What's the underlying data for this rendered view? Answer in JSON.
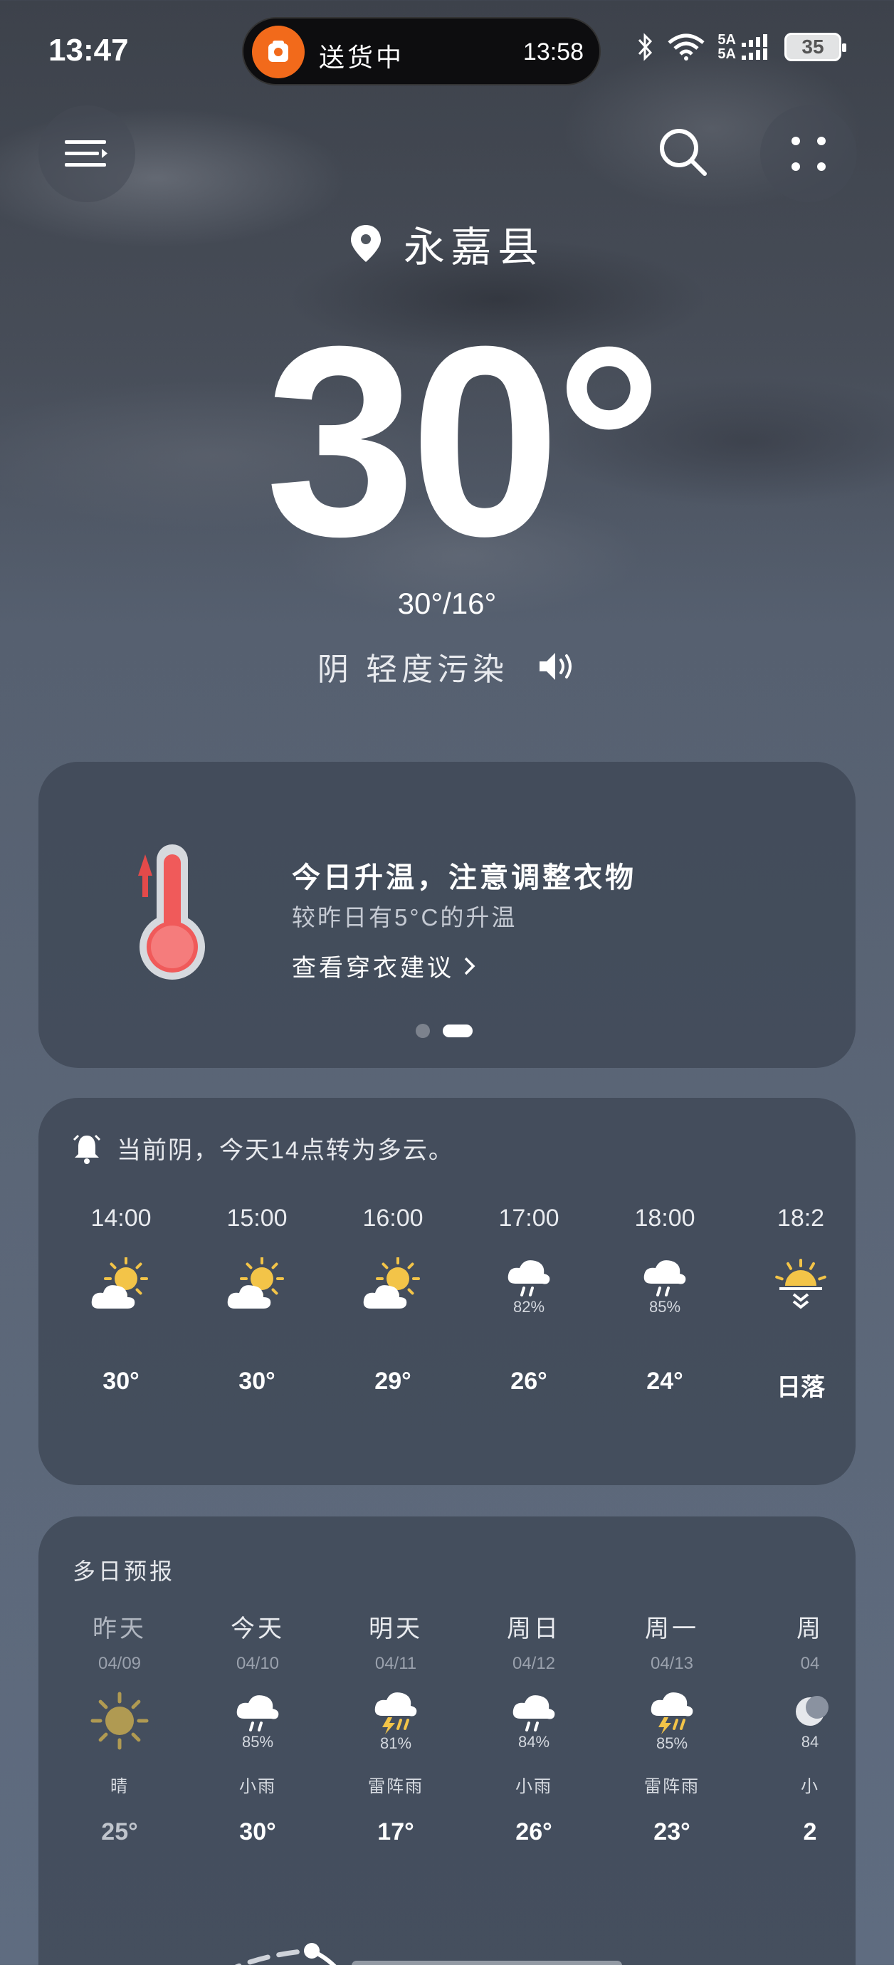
{
  "status_bar": {
    "time": "13:47",
    "island_text": "送货中",
    "island_time": "13:58",
    "network_a": "5A",
    "network_b": "5A",
    "battery": "35"
  },
  "location": {
    "name": "永嘉县"
  },
  "current": {
    "temperature": "30°",
    "high_low": "30°/16°",
    "condition": "阴 轻度污染"
  },
  "tip_card": {
    "title": "今日升温，注意调整衣物",
    "subtitle": "较昨日有5°C的升温",
    "link": "查看穿衣建议",
    "active_page": 2,
    "pages": 2
  },
  "hourly": {
    "alert": "当前阴，今天14点转为多云。",
    "items": [
      {
        "time": "14:00",
        "icon": "partly-sunny-icon",
        "prob": "",
        "temp": "30°"
      },
      {
        "time": "15:00",
        "icon": "partly-sunny-icon",
        "prob": "",
        "temp": "30°"
      },
      {
        "time": "16:00",
        "icon": "partly-sunny-icon",
        "prob": "",
        "temp": "29°"
      },
      {
        "time": "17:00",
        "icon": "rain-icon",
        "prob": "82%",
        "temp": "26°"
      },
      {
        "time": "18:00",
        "icon": "rain-icon",
        "prob": "85%",
        "temp": "24°"
      },
      {
        "time": "18:2",
        "icon": "sunset-icon",
        "prob": "",
        "temp": "日落"
      }
    ]
  },
  "daily": {
    "title": "多日预报",
    "items": [
      {
        "name": "昨天",
        "date": "04/09",
        "icon": "sun-icon",
        "prob": "",
        "desc": "晴",
        "temp": "25°",
        "past": true
      },
      {
        "name": "今天",
        "date": "04/10",
        "icon": "rain-icon",
        "prob": "85%",
        "desc": "小雨",
        "temp": "30°",
        "past": false
      },
      {
        "name": "明天",
        "date": "04/11",
        "icon": "thunderstorm-icon",
        "prob": "81%",
        "desc": "雷阵雨",
        "temp": "17°",
        "past": false
      },
      {
        "name": "周日",
        "date": "04/12",
        "icon": "rain-icon",
        "prob": "84%",
        "desc": "小雨",
        "temp": "26°",
        "past": false
      },
      {
        "name": "周一",
        "date": "04/13",
        "icon": "thunderstorm-icon",
        "prob": "85%",
        "desc": "雷阵雨",
        "temp": "23°",
        "past": false
      },
      {
        "name": "周",
        "date": "04",
        "icon": "moon-icon",
        "prob": "84",
        "desc": "小",
        "temp": "2",
        "past": false
      }
    ]
  },
  "colors": {
    "sun": "#f3c448",
    "past_sun": "#b09a52",
    "thermometer": "#f05a5a",
    "island_accent": "#f26a1b"
  }
}
